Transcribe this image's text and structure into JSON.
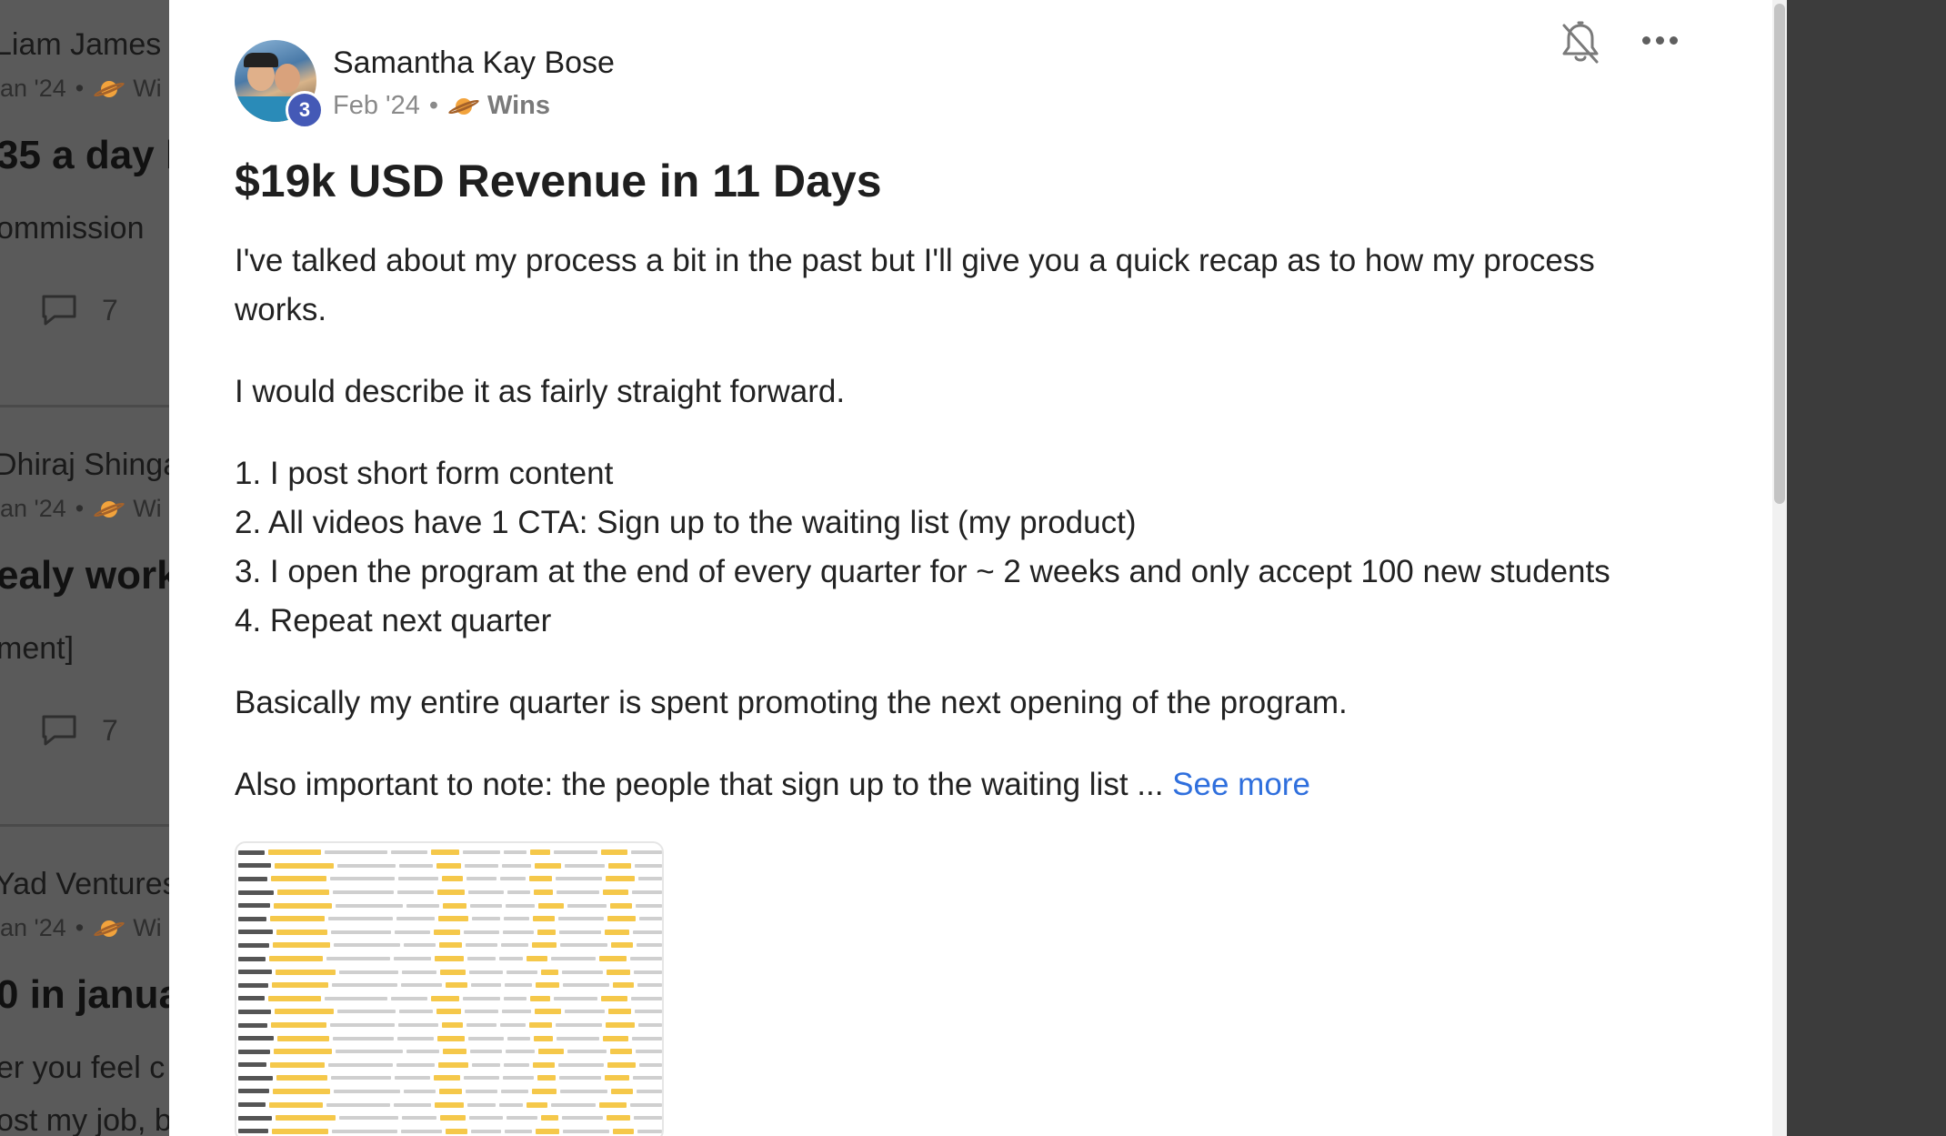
{
  "background_feed": [
    {
      "author": "Liam James",
      "date": "an '24",
      "category": "Wi",
      "title": "35 a day l",
      "snippet": "ommission",
      "comments": "7"
    },
    {
      "author": "Dhiraj Shinga",
      "date": "an '24",
      "category": "Wi",
      "title": "ealy works",
      "snippet": "ment]",
      "comments": "7"
    },
    {
      "author": "Yad Ventures",
      "date": "an '24",
      "category": "Wi",
      "title": "0 in januar",
      "snippet": "er you feel c",
      "snippet2": "ost my job, b"
    }
  ],
  "post": {
    "author": "Samantha Kay Bose",
    "level": "3",
    "date": "Feb '24",
    "separator": "•",
    "category": "Wins",
    "category_icon": "planet-icon",
    "title": "$19k USD Revenue in 11 Days",
    "paragraph1": "I've talked about my process a bit in the past but I'll give you a quick recap as to how my process works.",
    "paragraph2": "I would describe it as fairly straight forward.",
    "list": [
      "1. I post short form content",
      "2. All videos have 1 CTA: Sign up to the waiting list (my product)",
      "3. I open the program at the end of every quarter for ~ 2 weeks and only accept 100 new students",
      "4. Repeat next quarter"
    ],
    "paragraph3": "Basically my entire quarter is spent promoting the next opening of the program.",
    "paragraph4": "Also important to note: the people that sign up to the waiting list ... ",
    "see_more": "See more",
    "attachment_icon": "sales-notifications-screenshot"
  },
  "icons": {
    "bell": "bell-off-icon",
    "more": "more-options-icon",
    "comment": "comment-icon"
  },
  "colors": {
    "level_badge": "#4459b6",
    "link": "#2f6fdd",
    "overlay": "#3c3c3c"
  }
}
